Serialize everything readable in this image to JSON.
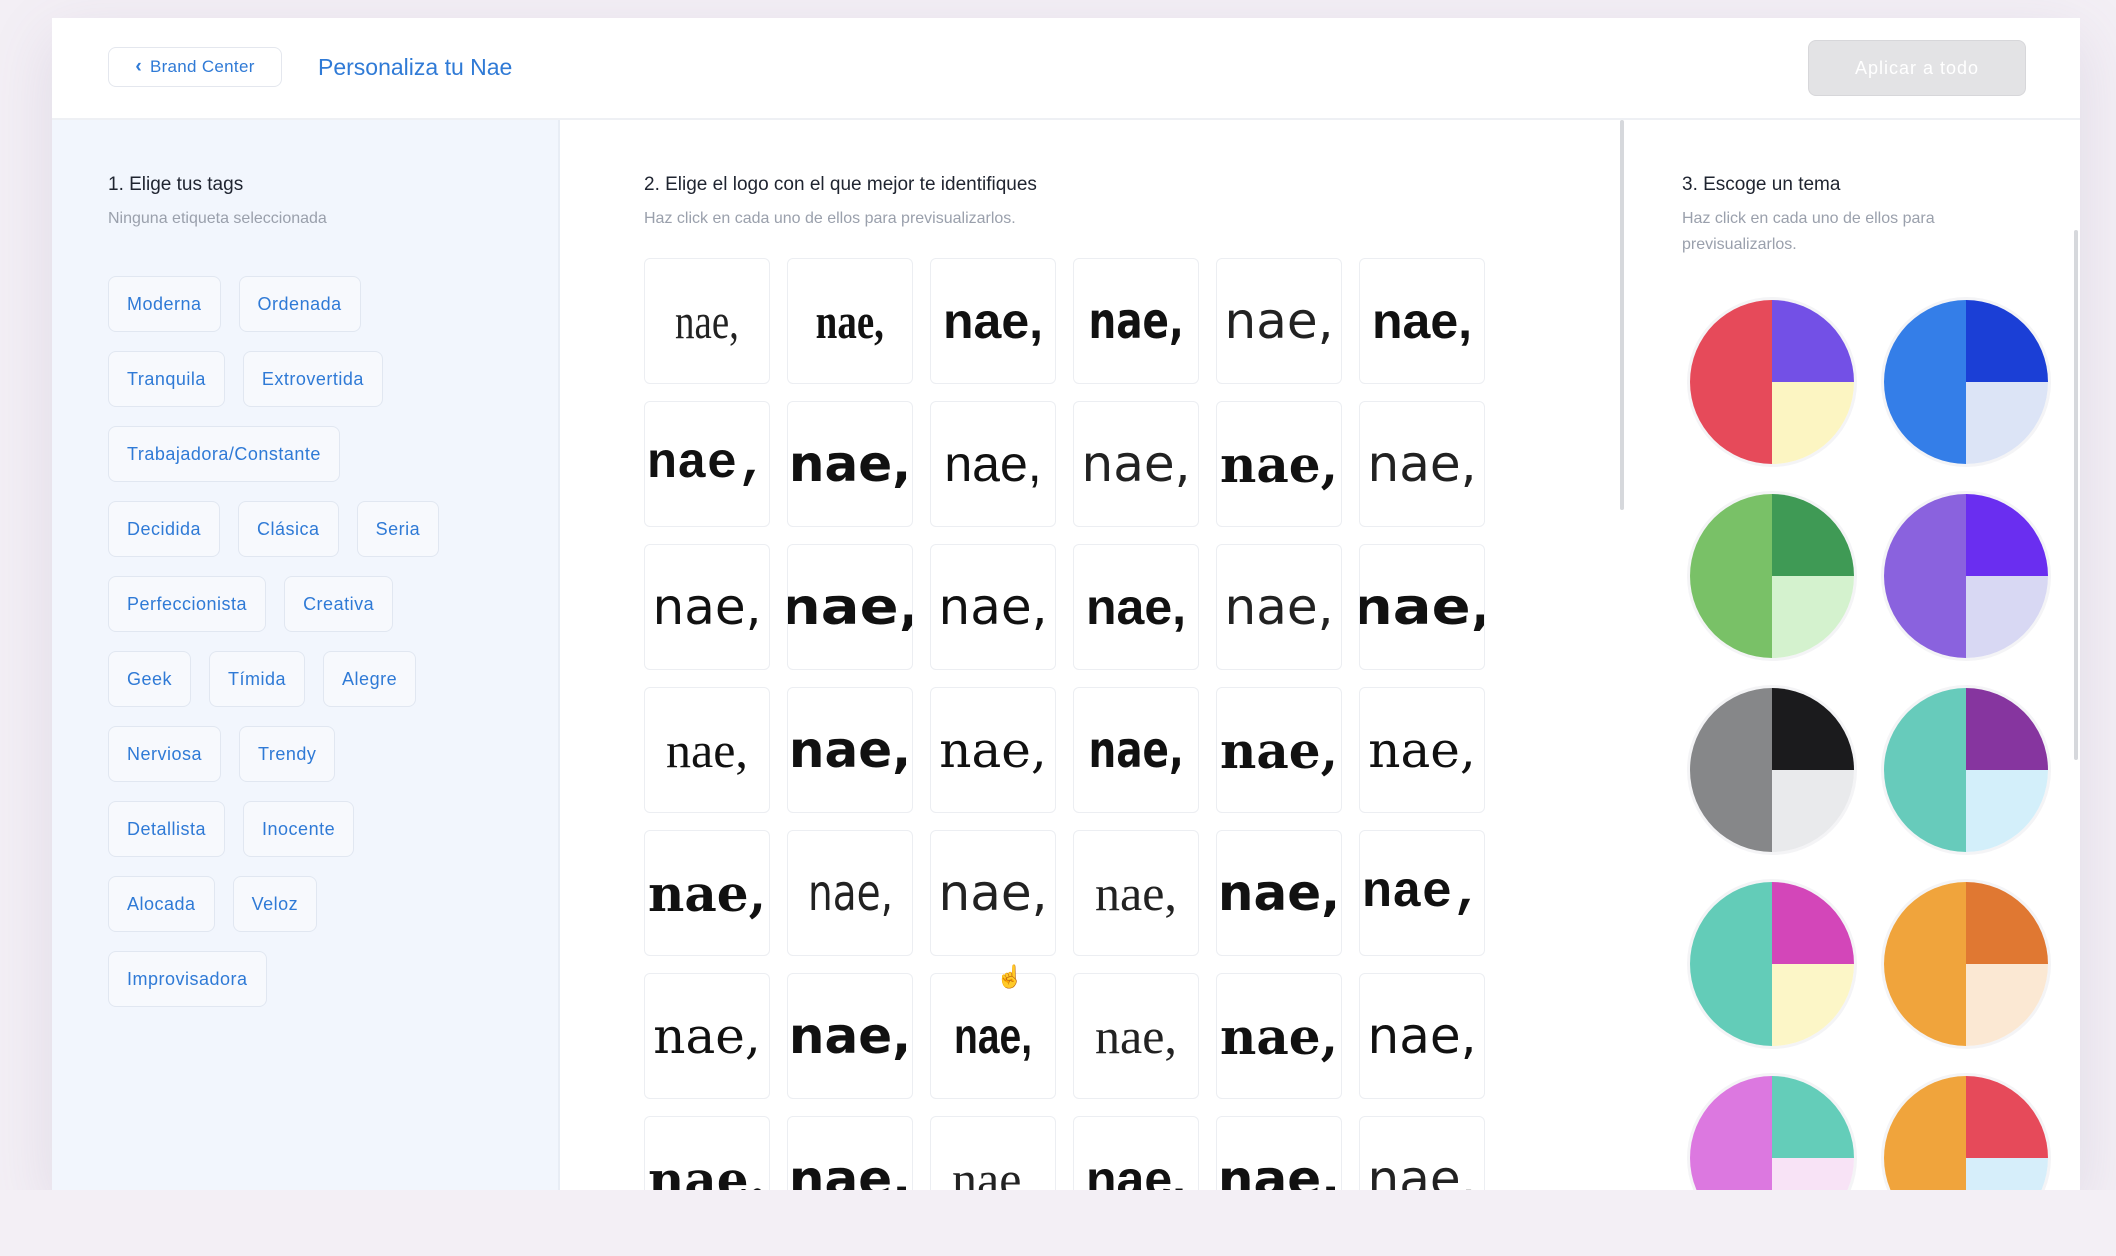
{
  "header": {
    "back_label": "Brand Center",
    "title": "Personaliza tu Nae",
    "apply_label": "Aplicar a todo"
  },
  "tags_section": {
    "title": "1. Elige tus tags",
    "subtitle": "Ninguna etiqueta seleccionada",
    "rows": [
      [
        "Moderna",
        "Ordenada"
      ],
      [
        "Tranquila",
        "Extrovertida"
      ],
      [
        "Trabajadora/Constante"
      ],
      [
        "Decidida",
        "Clásica",
        "Seria"
      ],
      [
        "Perfeccionista",
        "Creativa"
      ],
      [
        "Geek",
        "Tímida",
        "Alegre"
      ],
      [
        "Nerviosa",
        "Trendy"
      ],
      [
        "Detallista",
        "Inocente"
      ],
      [
        "Alocada",
        "Veloz"
      ],
      [
        "Improvisadora"
      ]
    ]
  },
  "logos_section": {
    "title": "2. Elige el logo con el que mejor te identifiques",
    "subtitle": "Haz click en cada uno de ellos para previsualizarlos.",
    "logo_text": [
      "nae,",
      "nae,",
      "nae,",
      "nae,",
      "nae,",
      "nae,",
      "nae,",
      "nae,",
      "nae,",
      "nae,",
      "nae,",
      "nae,",
      "nae,",
      "nae,",
      "nae,",
      "nae,",
      "nae,",
      "nae,",
      "nae,",
      "nae,",
      "nae,",
      "nae,",
      "nae,",
      "nae,",
      "nae,",
      "nae,",
      "nae,",
      "nae,",
      "nae,",
      "nae,",
      "nae,",
      "nae,",
      "nae,",
      "nae,",
      "nae,",
      "nae,",
      "nae.",
      "nae.",
      "nae.",
      "nae.",
      "nae.",
      "nae."
    ]
  },
  "themes_section": {
    "title": "3. Escoge un tema",
    "subtitle_line1": "Haz click en cada uno de ellos para",
    "subtitle_line2": "previsualizarlos.",
    "themes": [
      {
        "left": "#e64a5a",
        "top_right": "#7350e6",
        "bottom_right": "#fcf5c2"
      },
      {
        "left": "#347ee8",
        "top_right": "#1b3fd6",
        "bottom_right": "#dce4f6"
      },
      {
        "left": "#79c167",
        "top_right": "#3f9a55",
        "bottom_right": "#d4f2ce"
      },
      {
        "left": "#8a62de",
        "top_right": "#6a2ef0",
        "bottom_right": "#d8d8f3"
      },
      {
        "left": "#868789",
        "top_right": "#1b1b1d",
        "bottom_right": "#e9eaec"
      },
      {
        "left": "#67cbbb",
        "top_right": "#86359f",
        "bottom_right": "#d3effa"
      },
      {
        "left": "#63ccb8",
        "top_right": "#d346b9",
        "bottom_right": "#fcf6c7"
      },
      {
        "left": "#f0a43c",
        "top_right": "#e07832",
        "bottom_right": "#fbe8d3"
      },
      {
        "left": "#dc78e0",
        "top_right": "#64cdb9",
        "bottom_right": "#f8e3f6"
      },
      {
        "left": "#f0a43c",
        "top_right": "#e64a5a",
        "bottom_right": "#d6eefa"
      }
    ]
  }
}
